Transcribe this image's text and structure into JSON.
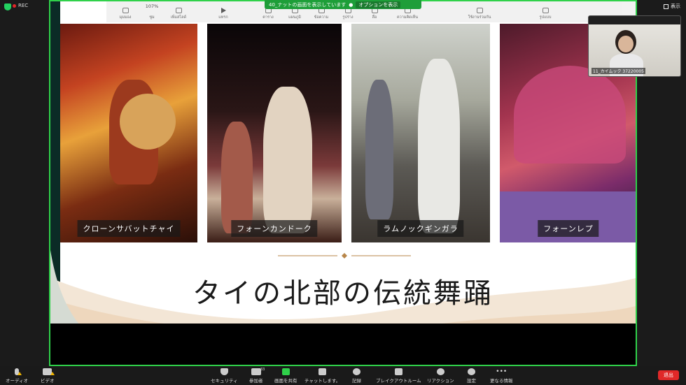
{
  "meeting": {
    "recording_label": "REC",
    "view_label": "表示",
    "share_banner_text": "40_ナットの画面を表示しています",
    "share_banner_options": "オプションを表示"
  },
  "ppt_toolbar": {
    "zoom": "107%",
    "items": [
      "มุมมอง",
      "ซูม",
      "เพิ่มสไลด์",
      "แทรก",
      "ตาราง",
      "แผนภูมิ",
      "ข้อความ",
      "รูปร่าง",
      "สื่อ",
      "ความคิดเห็น",
      "ใช้งานร่วมกัน",
      "รูปแบบ"
    ]
  },
  "slide": {
    "title": "タイの北部の伝統舞踊",
    "photos": [
      {
        "caption": "クローンサバットチャイ"
      },
      {
        "caption": "フォーンカンドーク"
      },
      {
        "caption": "ラムノックギンガラ"
      },
      {
        "caption": "フォーンレプ"
      }
    ]
  },
  "participant": {
    "name": "11_カイムック 37220005"
  },
  "bottom_toolbar": {
    "audio": "オーディオ",
    "video": "ビデオ",
    "security": "セキュリティ",
    "participants": "参加者",
    "participants_count": "33",
    "share_screen": "画面を共有",
    "chat": "チャットします。",
    "record": "記録",
    "breakout": "ブレイクアウトルーム",
    "reactions": "リアクション",
    "settings": "設定",
    "more": "更なる情報",
    "end": "退出"
  },
  "colors": {
    "share_border": "#2fd14a",
    "banner": "#1e9e39",
    "end_button": "#e02828",
    "warning": "#f0b400"
  }
}
